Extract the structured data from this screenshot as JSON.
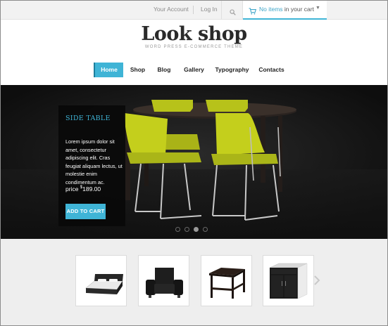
{
  "topbar": {
    "account_label": "Your Account",
    "login_label": "Log In",
    "search_icon": "search-icon",
    "cart_icon": "cart-icon",
    "cart_prefix": "No items",
    "cart_suffix": " in your cart"
  },
  "logo": {
    "title": "Look shop",
    "tagline": "WORD PRESS E-COMMERCE THEME"
  },
  "nav": {
    "items": [
      {
        "label": "Home",
        "active": true
      },
      {
        "label": "Shop"
      },
      {
        "label": "Blog"
      },
      {
        "label": "Gallery"
      },
      {
        "label": "Typography"
      },
      {
        "label": "Contacts"
      }
    ]
  },
  "hero": {
    "title": "SIDE TABLE",
    "description": "Lorem ipsum dolor sit amet, consectetur adipiscing elit. Cras feugiat aliquam lectus, ut molestie enim condimentum ac.",
    "price_label": "price ",
    "price_value": "$189.00",
    "button_label": "ADD TO CART",
    "slide_count": 4,
    "active_slide": 3
  },
  "products": {
    "items": [
      {
        "name": "bed-image"
      },
      {
        "name": "armchair-image"
      },
      {
        "name": "side-table-image"
      },
      {
        "name": "cabinet-image"
      }
    ],
    "next_icon": "chevron-right-icon"
  },
  "colors": {
    "accent": "#3fb4d6",
    "hero_bg": "#161616",
    "chair": "#c4cf1c"
  }
}
